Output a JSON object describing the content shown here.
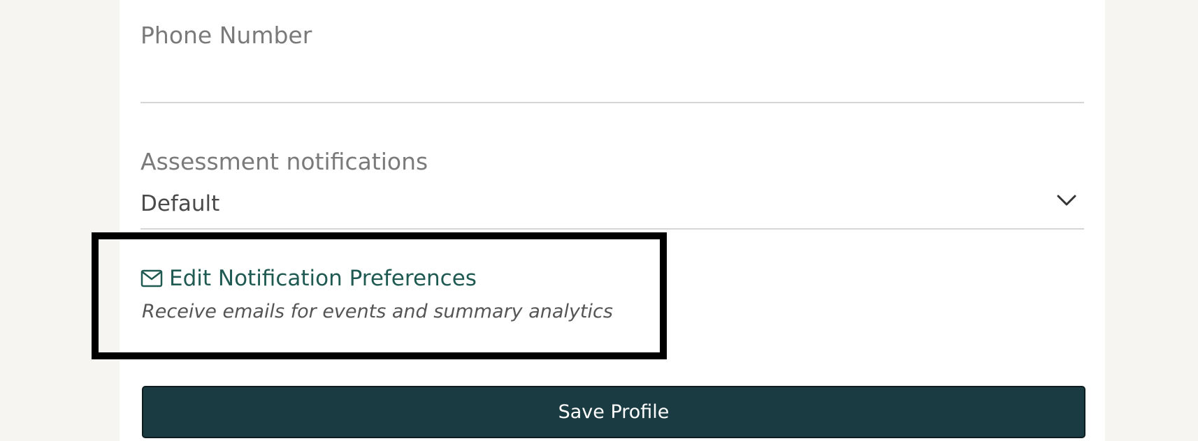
{
  "form": {
    "phone": {
      "label": "Phone Number",
      "value": ""
    },
    "assessment_notifications": {
      "label": "Assessment notifications",
      "selected": "Default",
      "icon": "chevron-down-icon"
    },
    "notification_preferences": {
      "link_label": "Edit Notification Preferences",
      "description": "Receive emails for events and summary analytics",
      "icon": "envelope-icon"
    },
    "save_label": "Save Profile"
  },
  "colors": {
    "page_background": "#f7f5f2",
    "card_background": "#ffffff",
    "link": "#1f5a52",
    "button": "#1b3b42",
    "highlight_border": "#000000"
  }
}
